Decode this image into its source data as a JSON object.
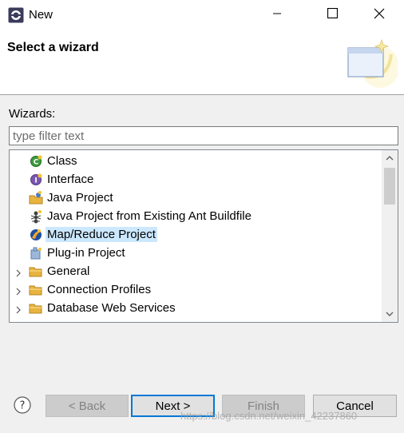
{
  "window": {
    "title": "New",
    "icon": "eclipse-icon",
    "controls": [
      "minimize-icon",
      "maximize-icon",
      "close-icon"
    ]
  },
  "header": {
    "title": "Select a wizard",
    "banner_icon": "new-wizard-banner-icon"
  },
  "wizards": {
    "label": "Wizards:",
    "filter_placeholder": "type filter text",
    "filter_value": "",
    "items": [
      {
        "label": "Class",
        "icon": "java-class-icon",
        "expandable": false
      },
      {
        "label": "Interface",
        "icon": "java-interface-icon",
        "expandable": false
      },
      {
        "label": "Java Project",
        "icon": "java-project-icon",
        "expandable": false
      },
      {
        "label": "Java Project from Existing Ant Buildfile",
        "icon": "ant-icon",
        "expandable": false
      },
      {
        "label": "Map/Reduce Project",
        "icon": "mapreduce-icon",
        "expandable": false,
        "selected": true
      },
      {
        "label": "Plug-in Project",
        "icon": "plugin-project-icon",
        "expandable": false
      },
      {
        "label": "General",
        "icon": "folder-icon",
        "expandable": true
      },
      {
        "label": "Connection Profiles",
        "icon": "folder-icon",
        "expandable": true
      },
      {
        "label": "Database Web Services",
        "icon": "folder-icon",
        "expandable": true
      }
    ]
  },
  "buttons": {
    "back": "< Back",
    "next": "Next >",
    "finish": "Finish",
    "cancel": "Cancel"
  },
  "watermark": "https://blog.csdn.net/weixin_42237860",
  "colors": {
    "selection": "#cce8ff",
    "default_button_border": "#0078d7",
    "folder": "#e8b440"
  }
}
